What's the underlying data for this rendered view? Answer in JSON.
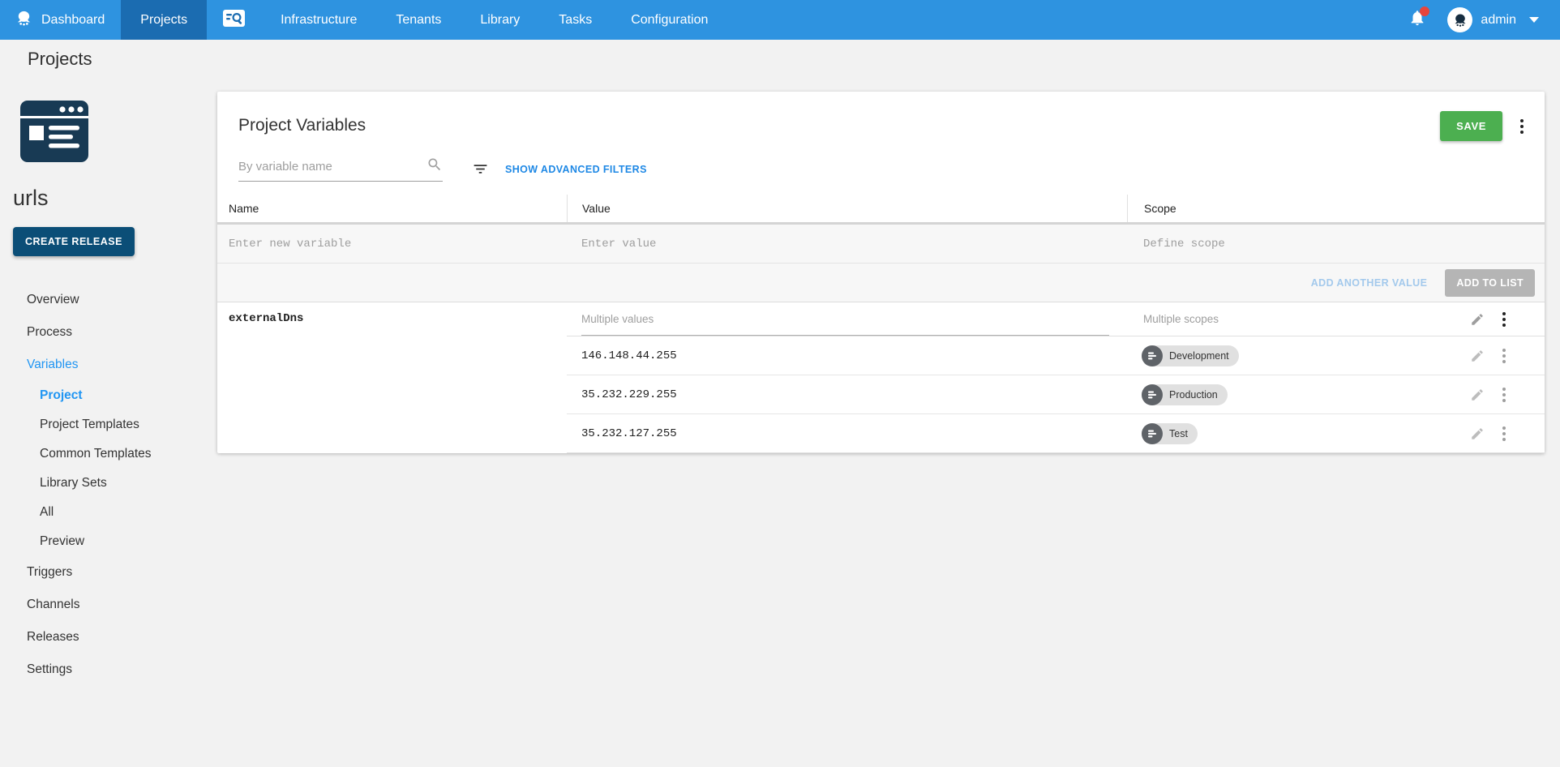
{
  "colors": {
    "nav_blue": "#2e93e0",
    "nav_active_blue": "#1b6cb1",
    "navy": "#0b4e77",
    "logo_navy": "#183a54",
    "link_blue": "#1e88e5",
    "active_item_blue": "#2196f3",
    "save_green": "#4caf50",
    "badge_red": "#e8453c",
    "chip_gray": "#e0e0e0",
    "chip_avatar_gray": "#5f6368"
  },
  "icons": {
    "brand": "octopus-icon",
    "nav_search": "project-search-icon",
    "notifications": "bell-icon",
    "user": "octopus-avatar-icon",
    "filter": "filter-list-icon",
    "search": "magnifier-icon",
    "edit": "pencil-icon",
    "overflow": "vertical-dots-icon",
    "scope": "environment-icon"
  },
  "top_nav": {
    "brand_label": "Dashboard",
    "items": [
      {
        "label": "Projects"
      },
      {
        "label": "Infrastructure"
      },
      {
        "label": "Tenants"
      },
      {
        "label": "Library"
      },
      {
        "label": "Tasks"
      },
      {
        "label": "Configuration"
      }
    ],
    "user_name": "admin"
  },
  "breadcrumb": {
    "title": "Projects"
  },
  "sidebar": {
    "project_name": "urls",
    "create_release_label": "CREATE RELEASE",
    "items": [
      {
        "label": "Overview"
      },
      {
        "label": "Process"
      },
      {
        "label": "Variables"
      },
      {
        "label": "Project"
      },
      {
        "label": "Project Templates"
      },
      {
        "label": "Common Templates"
      },
      {
        "label": "Library Sets"
      },
      {
        "label": "All"
      },
      {
        "label": "Preview"
      },
      {
        "label": "Triggers"
      },
      {
        "label": "Channels"
      },
      {
        "label": "Releases"
      },
      {
        "label": "Settings"
      }
    ]
  },
  "variables_card": {
    "title": "Project Variables",
    "save_label": "SAVE",
    "filter": {
      "placeholder": "By variable name",
      "advanced_label": "SHOW ADVANCED FILTERS"
    },
    "table": {
      "headers": [
        "Name",
        "Value",
        "Scope"
      ],
      "new_row": {
        "name_placeholder": "Enter new variable",
        "value_placeholder": "Enter value",
        "scope_placeholder": "Define scope"
      },
      "actions": {
        "add_another_label": "ADD ANOTHER VALUE",
        "add_to_list_label": "ADD TO LIST"
      },
      "variables": [
        {
          "name": "externalDns",
          "value_summary": "Multiple values",
          "scope_summary": "Multiple scopes",
          "entries": [
            {
              "value": "146.148.44.255",
              "scope": "Development"
            },
            {
              "value": "35.232.229.255",
              "scope": "Production"
            },
            {
              "value": "35.232.127.255",
              "scope": "Test"
            }
          ]
        }
      ]
    }
  }
}
